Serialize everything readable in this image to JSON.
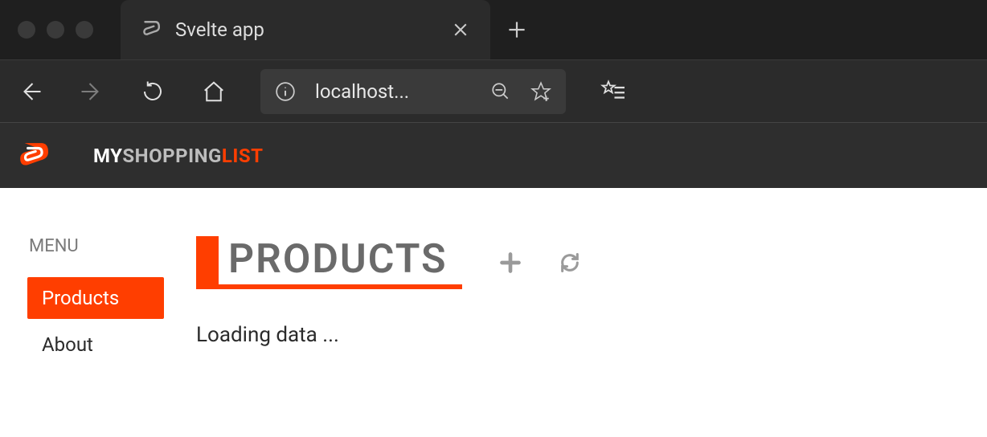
{
  "browser": {
    "tab_title": "Svelte app",
    "address": "localhost..."
  },
  "header": {
    "brand_p1": "MY",
    "brand_p2": "SHOPPING",
    "brand_p3": "LIST"
  },
  "sidebar": {
    "label": "MENU",
    "items": [
      {
        "label": "Products",
        "active": true
      },
      {
        "label": "About",
        "active": false
      }
    ]
  },
  "main": {
    "title": "PRODUCTS",
    "status": "Loading data ..."
  }
}
